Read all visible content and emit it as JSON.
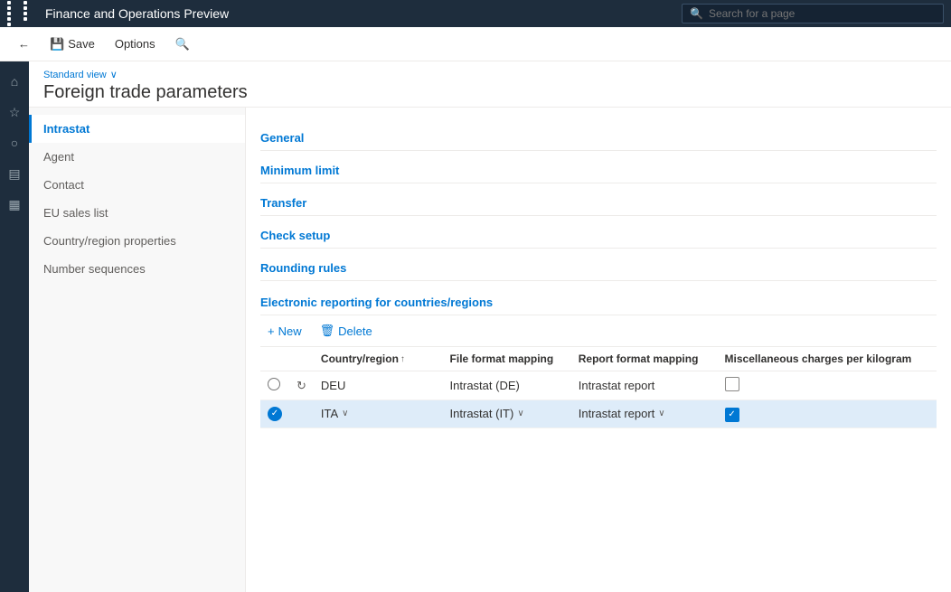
{
  "topBar": {
    "title": "Finance and Operations Preview",
    "searchPlaceholder": "Search for a page"
  },
  "toolbar": {
    "backLabel": "",
    "saveLabel": "Save",
    "optionsLabel": "Options",
    "searchLabel": ""
  },
  "pageHeader": {
    "viewLabel": "Standard view",
    "title": "Foreign trade parameters"
  },
  "sideMenu": {
    "items": [
      {
        "label": "Intrastat",
        "active": true
      },
      {
        "label": "Agent",
        "active": false
      },
      {
        "label": "Contact",
        "active": false
      },
      {
        "label": "EU sales list",
        "active": false
      },
      {
        "label": "Country/region properties",
        "active": false
      },
      {
        "label": "Number sequences",
        "active": false
      }
    ]
  },
  "formSections": [
    {
      "label": "General"
    },
    {
      "label": "Minimum limit"
    },
    {
      "label": "Transfer"
    },
    {
      "label": "Check setup"
    },
    {
      "label": "Rounding rules"
    }
  ],
  "electronicReporting": {
    "sectionTitle": "Electronic reporting for countries/regions",
    "toolbar": {
      "newLabel": "New",
      "deleteLabel": "Delete"
    },
    "table": {
      "columns": [
        {
          "label": ""
        },
        {
          "label": ""
        },
        {
          "label": "Country/region",
          "sortable": true
        },
        {
          "label": ""
        },
        {
          "label": "File format mapping"
        },
        {
          "label": "Report format mapping"
        },
        {
          "label": "Miscellaneous charges per kilogram"
        }
      ],
      "rows": [
        {
          "selected": false,
          "indicator": "radio",
          "country": "DEU",
          "fileFormat": "Intrastat (DE)",
          "reportFormat": "Intrastat report",
          "miscCharges": false
        },
        {
          "selected": true,
          "indicator": "dot",
          "country": "ITA",
          "fileFormat": "Intrastat (IT)",
          "reportFormat": "Intrastat report",
          "miscCharges": true
        }
      ]
    }
  },
  "icons": {
    "gridIcon": "⊞",
    "homeIcon": "⌂",
    "starIcon": "☆",
    "clockIcon": "○",
    "listIcon": "▤",
    "dataIcon": "▦",
    "backArrow": "←",
    "saveIcon": "💾",
    "searchIcon": "🔍",
    "chevronDown": "∨",
    "plusIcon": "+",
    "trashIcon": "🗑",
    "checkmark": "✓",
    "sortUp": "↑",
    "refreshIcon": "↻"
  }
}
